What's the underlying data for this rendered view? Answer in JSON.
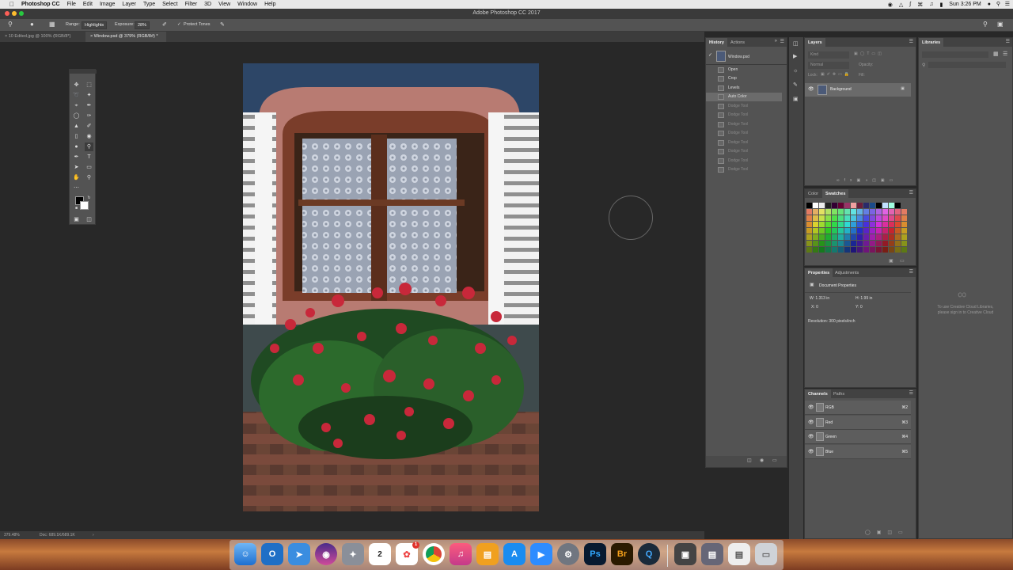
{
  "menubar": {
    "app_name": "Photoshop CC",
    "items": [
      "File",
      "Edit",
      "Image",
      "Layer",
      "Type",
      "Select",
      "Filter",
      "3D",
      "View",
      "Window",
      "Help"
    ],
    "clock": "Sun 3:26 PM"
  },
  "window": {
    "title": "Adobe Photoshop CC 2017"
  },
  "options_bar": {
    "range_label": "Range:",
    "range_value": "Highlights",
    "exposure_label": "Exposure:",
    "exposure_value": "28%",
    "protect_tones_label": "Protect Tones"
  },
  "document_tabs": [
    {
      "label": "10 Edited.jpg @ 100% (RGB/8*)",
      "active": false
    },
    {
      "label": "Window.psd @ 379% (RGB/8#) *",
      "active": true
    }
  ],
  "status_bar": {
    "zoom": "379.48%",
    "doc_info": "Doc: 689.1K/689.1K"
  },
  "history_panel": {
    "tabs": [
      "History",
      "Actions"
    ],
    "snapshot": "Window.psd",
    "steps": [
      {
        "label": "Open",
        "state": "normal"
      },
      {
        "label": "Crop",
        "state": "normal"
      },
      {
        "label": "Levels",
        "state": "normal"
      },
      {
        "label": "Auto Color",
        "state": "selected"
      },
      {
        "label": "Dodge Tool",
        "state": "disabled"
      },
      {
        "label": "Dodge Tool",
        "state": "disabled"
      },
      {
        "label": "Dodge Tool",
        "state": "disabled"
      },
      {
        "label": "Dodge Tool",
        "state": "disabled"
      },
      {
        "label": "Dodge Tool",
        "state": "disabled"
      },
      {
        "label": "Dodge Tool",
        "state": "disabled"
      },
      {
        "label": "Dodge Tool",
        "state": "disabled"
      },
      {
        "label": "Dodge Tool",
        "state": "disabled"
      }
    ]
  },
  "layers_panel": {
    "tab": "Layers",
    "kind_placeholder": "Kind",
    "blend_mode": "Normal",
    "opacity_label": "Opacity:",
    "lock_label": "Lock:",
    "fill_label": "Fill:",
    "layers": [
      {
        "name": "Background"
      }
    ]
  },
  "libraries_panel": {
    "tab": "Libraries",
    "message_line1": "To use Creative Cloud Libraries,",
    "message_line2": "please sign in to Creative Cloud"
  },
  "color_panel": {
    "tabs": [
      "Color",
      "Swatches"
    ]
  },
  "properties_panel": {
    "tabs": [
      "Properties",
      "Adjustments"
    ],
    "heading": "Document Properties",
    "w": "W: 1.313 in",
    "h": "H: 1.99 in",
    "x": "X: 0",
    "y": "Y: 0",
    "resolution": "Resolution: 300 pixels/inch"
  },
  "channels_panel": {
    "tabs": [
      "Channels",
      "Paths"
    ],
    "channels": [
      {
        "name": "RGB",
        "shortcut": "⌘2"
      },
      {
        "name": "Red",
        "shortcut": "⌘3"
      },
      {
        "name": "Green",
        "shortcut": "⌘4"
      },
      {
        "name": "Blue",
        "shortcut": "⌘5"
      }
    ]
  },
  "dock": {
    "calendar_month": "DEC",
    "calendar_day": "2",
    "photoshop_label": "Ps",
    "bridge_label": "Br",
    "photos_badge": "1"
  },
  "colors": {
    "panel": "#535353",
    "panel_dark": "#3a3a3a",
    "canvas": "#282828",
    "history_selected": "#6b6b6b"
  }
}
